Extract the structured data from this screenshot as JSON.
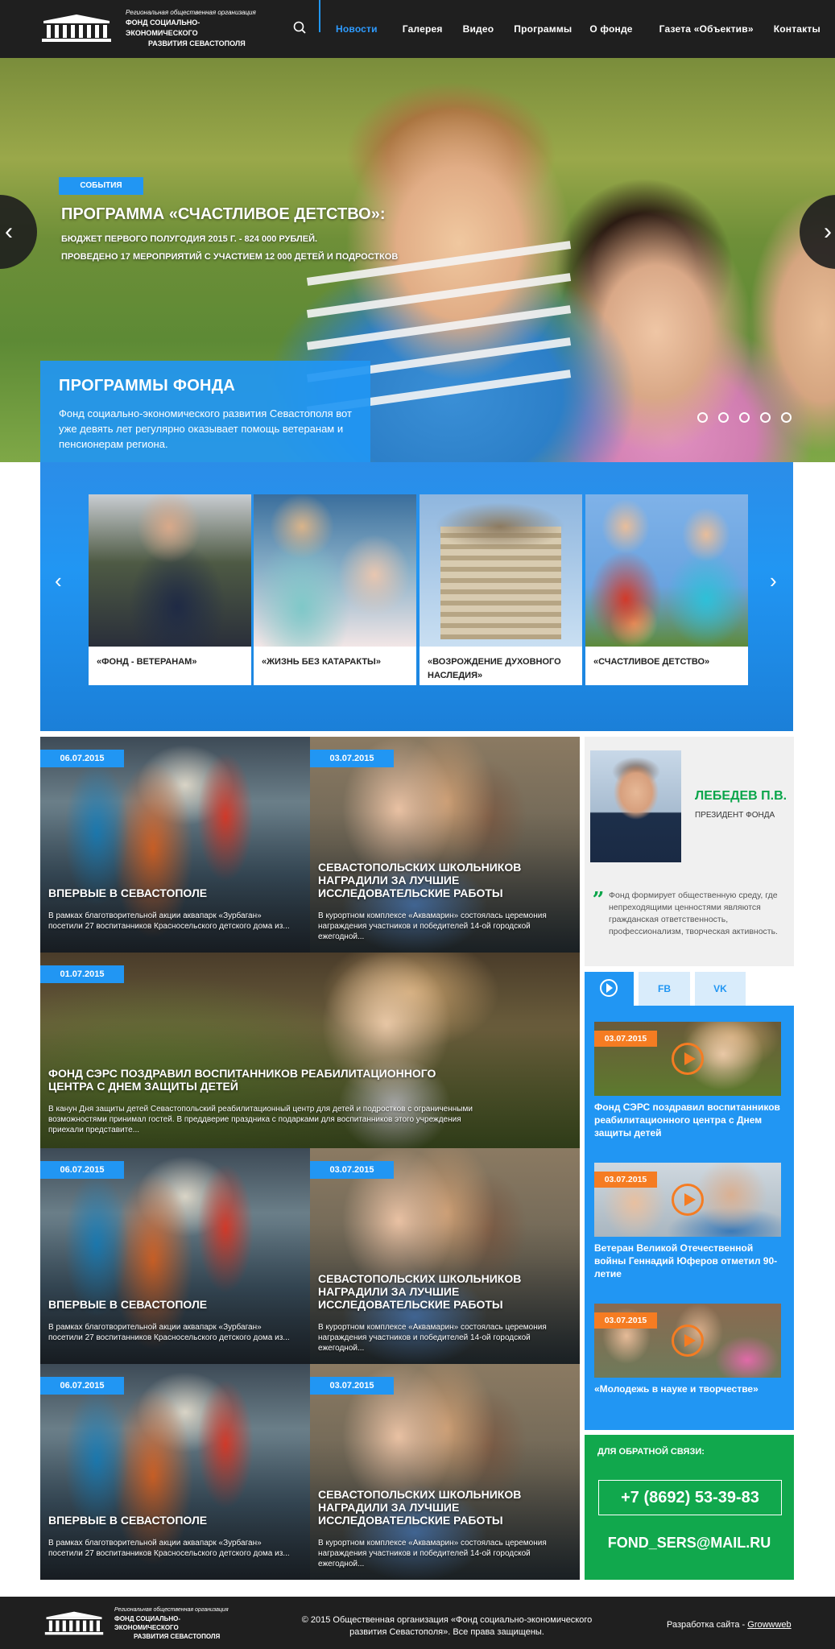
{
  "header": {
    "logo": {
      "line1": "Региональная общественная организация",
      "line2": "Фонд социально-экономического",
      "line3": "развития Севастополя"
    },
    "nav": [
      "Новости",
      "Галерея",
      "Видео",
      "Программы",
      "О фонде",
      "Газета «Объектив»",
      "Контакты"
    ],
    "active_nav": "Новости"
  },
  "hero": {
    "tag": "События",
    "title": "ПРОГРАММА «СЧАСТЛИВОЕ ДЕТСТВО»:",
    "line1": "БЮДЖЕТ ПЕРВОГО ПОЛУГОДИЯ 2015 Г. - 824 000 РУБЛЕЙ.",
    "line2": "ПРОВЕДЕНО 17 МЕРОПРИЯТИЙ С УЧАСТИЕМ 12 000 ДЕТЕЙ И ПОДРОСТКОВ",
    "slide_count": 5,
    "prev_glyph": "‹",
    "next_glyph": "›"
  },
  "programs": {
    "title": "ПРОГРАММЫ ФОНДА",
    "text": "Фонд социально-экономического развития Севастополя вот уже девять лет регулярно оказывает помощь ветеранам и пенсионерам региона.",
    "cards": [
      "«Фонд - ветеранам»",
      "«Жизнь без катаракты»",
      "«Возрождение духовного наследия»",
      "«Счастливое детство»"
    ],
    "prev_glyph": "‹",
    "next_glyph": "›"
  },
  "news": [
    {
      "date": "06.07.2015",
      "title": "Впервые в Севастополе",
      "desc": "В рамках благотворительной акции аквапарк «Зурбаган» посетили 27 воспитанников Красносельского детского дома из..."
    },
    {
      "date": "03.07.2015",
      "title": "Севастопольских школьников наградили за лучшие исследовательские работы",
      "desc": "В курортном комплексе «Аквамарин» состоялась церемония награждения участников и победителей 14-ой городской ежегодной..."
    },
    {
      "date": "01.07.2015",
      "title": "Фонд СЭРС поздравил воспитанников реабилитационного центра с Днем защиты детей",
      "desc": "В канун Дня защиты детей Севастопольский реабилитационный центр для детей и подростков с ограниченными возможностями принимал гостей. В преддверие праздника с подарками для воспитанников этого учреждения приехали представите..."
    },
    {
      "date": "06.07.2015",
      "title": "Впервые в Севастополе",
      "desc": "В рамках благотворительной акции аквапарк «Зурбаган» посетили 27 воспитанников Красносельского детского дома из..."
    },
    {
      "date": "03.07.2015",
      "title": "Севастопольских школьников наградили за лучшие исследовательские работы",
      "desc": "В курортном комплексе «Аквамарин» состоялась церемония награждения участников и победителей 14-ой городской ежегодной..."
    },
    {
      "date": "06.07.2015",
      "title": "Впервые в Севастополе",
      "desc": "В рамках благотворительной акции аквапарк «Зурбаган» посетили 27 воспитанников Красносельского детского дома из..."
    },
    {
      "date": "03.07.2015",
      "title": "Севастопольских школьников наградили за лучшие исследовательские работы",
      "desc": "В курортном комплексе «Аквамарин» состоялась церемония награждения участников и победителей 14-ой городской ежегодной..."
    }
  ],
  "president": {
    "name": "ЛЕБЕДЕВ П.В.",
    "role": "ПРЕЗИДЕНТ ФОНДА",
    "quote_mark": "„",
    "quote": "Фонд формирует общественную среду, где непреходящими ценностями являются гражданская ответственность, профессионализм, творческая активность."
  },
  "media": {
    "tabs": [
      "FB",
      "VK"
    ],
    "items": [
      {
        "date": "03.07.2015",
        "title": "Фонд СЭРС поздравил воспитанников реабилитационного центра с Днем защиты детей"
      },
      {
        "date": "03.07.2015",
        "title": "Ветеран Великой Отечественной войны Геннадий Юферов отметил 90-летие"
      },
      {
        "date": "03.07.2015",
        "title": "«Молодежь в науке и творчестве»"
      }
    ]
  },
  "contact": {
    "label": "ДЛЯ ОБРАТНОЙ СВЯЗИ:",
    "phone": "+7 (8692) 53-39-83",
    "email": "FOND_SERS@MAIL.RU"
  },
  "footer": {
    "copyright": "© 2015 Общественная организация «Фонд социально-экономического развития Севастополя». Все права защищены.",
    "dev_label": "Разработка сайта -",
    "dev_link": "Growwweb"
  },
  "colors": {
    "accent": "#2196f3",
    "green": "#11a84d",
    "orange": "#f57c22",
    "dark": "#1f1f1f"
  },
  "icons": [
    "search-icon",
    "play-icon",
    "chevron-left-icon",
    "chevron-right-icon",
    "quote-icon"
  ]
}
